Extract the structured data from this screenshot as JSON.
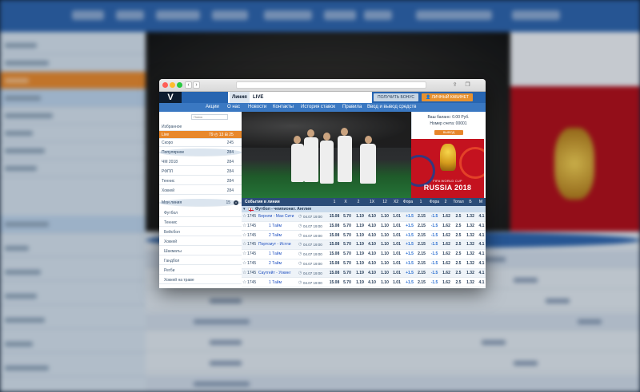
{
  "header": {
    "logo": "V",
    "tabs": [
      {
        "label": "Линия",
        "active": true
      },
      {
        "label": "LIVE",
        "active": false
      }
    ],
    "bonus_button": "ПОЛУЧИТЬ БОНУС",
    "cabinet_button": "ЛИЧНЫЙ КАБИНЕТ"
  },
  "nav": [
    "Акции",
    "О нас",
    "Новости",
    "Контакты",
    "История ставок",
    "Правила",
    "Ввод и вывод средств"
  ],
  "sidebar": {
    "search_placeholder": "Поиск",
    "items": [
      {
        "label": "Избранное",
        "count": "",
        "style": "plain"
      },
      {
        "label": "Live",
        "count": "25",
        "extra": "79   ◴ 13   ⊞ 25",
        "style": "orange"
      },
      {
        "label": "Скоро",
        "count": "245",
        "style": "plain"
      },
      {
        "label": "Популярное",
        "count": "284",
        "style": "head"
      },
      {
        "label": "ЧМ 2018",
        "count": "284",
        "style": "plain"
      },
      {
        "label": "РФПЛ",
        "count": "284",
        "style": "plain"
      },
      {
        "label": "Теннис",
        "count": "284",
        "style": "plain"
      },
      {
        "label": "Хоккей",
        "count": "284",
        "style": "plain"
      }
    ],
    "my_line": {
      "label": "Мои линия",
      "count": "15"
    },
    "sub_items": [
      "Футбол",
      "Теннис",
      "Бейсбол",
      "Хоккей",
      "Шахматы",
      "Гандбол",
      "Регби",
      "Хоккей на траве"
    ]
  },
  "account": {
    "balance": "Ваш баланс: 0.00 Руб.",
    "account_no": "Номер счета: 00001",
    "withdraw": "ВЫВОД"
  },
  "ad": {
    "subtitle": "FIFA WORLD CUP",
    "title": "RUSSIA 2018",
    "colors": {
      "bg": "#c4121f",
      "gold": "#f6d54b"
    }
  },
  "events": {
    "columns": [
      "События в линии",
      "1",
      "X",
      "2",
      "1X",
      "12",
      "X2",
      "Фора",
      "1",
      "Фора",
      "2",
      "Тотал",
      "Б",
      "М"
    ],
    "league": "Футбол - чемпионат. Англия",
    "rows": [
      {
        "id": "1745",
        "name": "Бернли - Ман Сити",
        "type": "match",
        "time": "04.07 19:00",
        "odds": [
          "15.08",
          "5.70",
          "1.19",
          "4.10",
          "1.10",
          "1.01",
          "+1.5",
          "2.15",
          "-1.5",
          "1.62",
          "2.5",
          "1.32",
          "4.1"
        ]
      },
      {
        "id": "1745",
        "name": "1 Тайм",
        "type": "half",
        "time": "04.07 19:00",
        "odds": [
          "15.08",
          "5.70",
          "1.19",
          "4.10",
          "1.10",
          "1.01",
          "+1.5",
          "2.15",
          "-1.5",
          "1.62",
          "2.5",
          "1.32",
          "4.1"
        ]
      },
      {
        "id": "1745",
        "name": "2 Тайм",
        "type": "half",
        "time": "04.07 19:00",
        "odds": [
          "15.08",
          "5.70",
          "1.19",
          "4.10",
          "1.10",
          "1.01",
          "+1.5",
          "2.15",
          "-1.5",
          "1.62",
          "2.5",
          "1.32",
          "4.1"
        ]
      },
      {
        "id": "1745",
        "name": "Портсмут - Истли",
        "type": "match",
        "time": "04.07 19:00",
        "odds": [
          "15.08",
          "5.70",
          "1.19",
          "4.10",
          "1.10",
          "1.01",
          "+1.5",
          "2.15",
          "-1.5",
          "1.62",
          "2.5",
          "1.32",
          "4.1"
        ]
      },
      {
        "id": "1745",
        "name": "1 Тайм",
        "type": "half",
        "time": "04.07 19:00",
        "odds": [
          "15.08",
          "5.70",
          "1.19",
          "4.10",
          "1.10",
          "1.01",
          "+1.5",
          "2.15",
          "-1.5",
          "1.62",
          "2.5",
          "1.32",
          "4.1"
        ]
      },
      {
        "id": "1745",
        "name": "2 Тайм",
        "type": "half",
        "time": "04.07 19:00",
        "odds": [
          "15.08",
          "5.70",
          "1.19",
          "4.10",
          "1.10",
          "1.01",
          "+1.5",
          "2.15",
          "-1.5",
          "1.62",
          "2.5",
          "1.32",
          "4.1"
        ]
      },
      {
        "id": "1745",
        "name": "Саутгейт - Уокинг",
        "type": "match",
        "time": "04.07 19:00",
        "odds": [
          "15.08",
          "5.70",
          "1.19",
          "4.10",
          "1.10",
          "1.01",
          "+1.5",
          "2.15",
          "-1.5",
          "1.62",
          "2.5",
          "1.32",
          "4.1"
        ]
      },
      {
        "id": "1745",
        "name": "1 Тайм",
        "type": "half",
        "time": "04.07 19:00",
        "odds": [
          "15.08",
          "5.70",
          "1.19",
          "4.10",
          "1.10",
          "1.01",
          "+1.5",
          "2.15",
          "-1.5",
          "1.62",
          "2.5",
          "1.32",
          "4.1"
        ]
      }
    ]
  },
  "colors": {
    "brand_blue": "#2765b1",
    "accent_orange": "#e8882c",
    "dark": "#0d1c2f"
  }
}
